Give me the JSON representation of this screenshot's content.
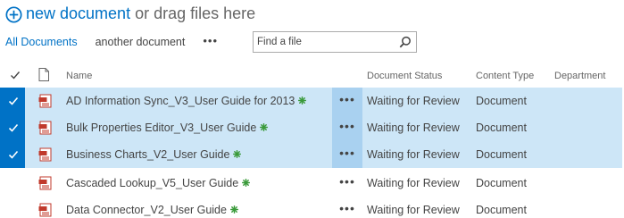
{
  "toolbar": {
    "new_document": "new document",
    "or_drag": "or drag files here"
  },
  "views": {
    "all_documents": "All Documents",
    "another_document": "another document",
    "more": "•••"
  },
  "search": {
    "placeholder": "Find a file"
  },
  "columns": {
    "name": "Name",
    "document_status": "Document Status",
    "content_type": "Content Type",
    "department": "Department"
  },
  "rows": [
    {
      "title": "AD Information Sync_V3_User Guide for 2013",
      "status": "Waiting for Review",
      "content_type": "Document",
      "selected": true,
      "icon": "pdf-icon",
      "new_badge": "new-icon"
    },
    {
      "title": "Bulk Properties Editor_V3_User Guide",
      "status": "Waiting for Review",
      "content_type": "Document",
      "selected": true,
      "icon": "pdf-icon",
      "new_badge": "new-icon"
    },
    {
      "title": "Business Charts_V2_User Guide",
      "status": "Waiting for Review",
      "content_type": "Document",
      "selected": true,
      "icon": "pdf-icon",
      "new_badge": "new-icon"
    },
    {
      "title": "Cascaded Lookup_V5_User Guide",
      "status": "Waiting for Review",
      "content_type": "Document",
      "selected": false,
      "icon": "pdf-icon",
      "new_badge": "new-icon"
    },
    {
      "title": "Data Connector_V2_User Guide",
      "status": "Waiting for Review",
      "content_type": "Document",
      "selected": false,
      "icon": "pdf-icon",
      "new_badge": "new-icon"
    }
  ],
  "ellipsis": "•••",
  "colors": {
    "accent": "#0072c6",
    "selected_row": "#cde6f7",
    "selected_ellipsis": "#a9d1f0",
    "new_badge": "#3a9a3a",
    "pdf_red": "#c0392b"
  }
}
